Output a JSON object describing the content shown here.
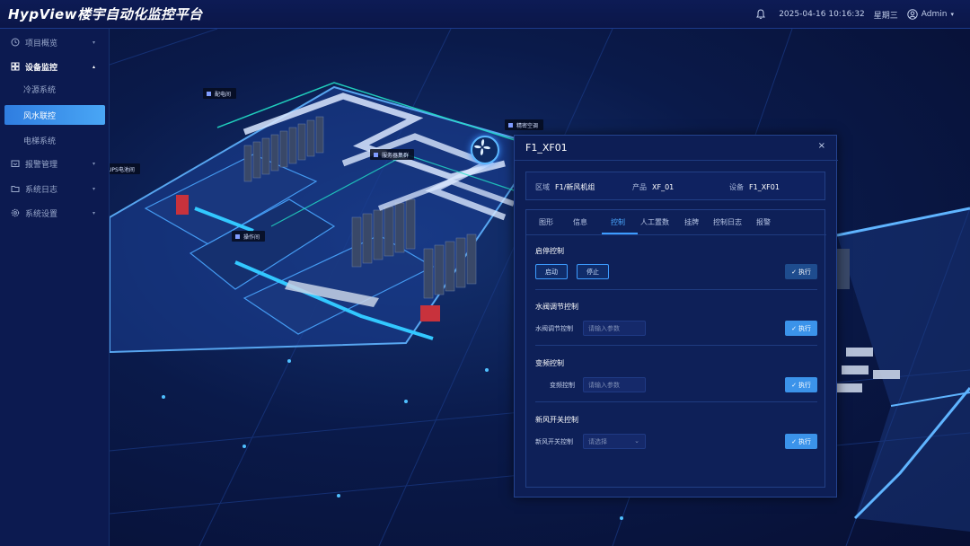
{
  "header": {
    "title": "HypView楼宇自动化监控平台",
    "datetime": "2025-04-16 10:16:32",
    "weekday": "星期三",
    "user": "Admin",
    "user_caret": "▾"
  },
  "sidebar": {
    "items": [
      {
        "label": "项目概览",
        "icon": "clock-icon",
        "arrow": "▾"
      },
      {
        "label": "设备监控",
        "icon": "grid-icon",
        "arrow": "▴"
      },
      {
        "label": "报警管理",
        "icon": "alarm-icon",
        "arrow": "▾"
      },
      {
        "label": "系统日志",
        "icon": "folder-icon",
        "arrow": "▾"
      },
      {
        "label": "系统设置",
        "icon": "gear-icon",
        "arrow": "▾"
      }
    ],
    "sub_items": [
      {
        "label": "冷源系统"
      },
      {
        "label": "风水联控"
      },
      {
        "label": "电梯系统"
      }
    ]
  },
  "scene": {
    "tags": [
      {
        "label": "配电间"
      },
      {
        "label": "精密空调"
      },
      {
        "label": "服务器集群"
      },
      {
        "label": "操作间"
      },
      {
        "label": "UPS电池间"
      }
    ]
  },
  "dialog": {
    "title": "F1_XF01",
    "close": "×",
    "info": {
      "area_label": "区域",
      "area_value": "F1/新风机组",
      "product_label": "产品",
      "product_value": "XF_01",
      "device_label": "设备",
      "device_value": "F1_XF01"
    },
    "tabs": [
      "图形",
      "信息",
      "控制",
      "人工置数",
      "挂牌",
      "控制日志",
      "报警"
    ],
    "sections": {
      "start_stop": {
        "title": "启停控制",
        "start": "启动",
        "stop": "停止"
      },
      "valve": {
        "title": "水阀调节控制",
        "label": "水阀调节控制",
        "placeholder": "请输入参数"
      },
      "freq": {
        "title": "变频控制",
        "label": "变频控制",
        "placeholder": "请输入参数"
      },
      "fresh": {
        "title": "新风开关控制",
        "label": "新风开关控制",
        "placeholder": "请选择"
      }
    },
    "exec_label": "执行"
  },
  "colors": {
    "accent": "#3d9cff",
    "header_bg": "#0d1b55",
    "sidebar_bg": "#0c1a50",
    "active_gradient_start": "#2f7de0",
    "active_gradient_end": "#49a6f5"
  }
}
